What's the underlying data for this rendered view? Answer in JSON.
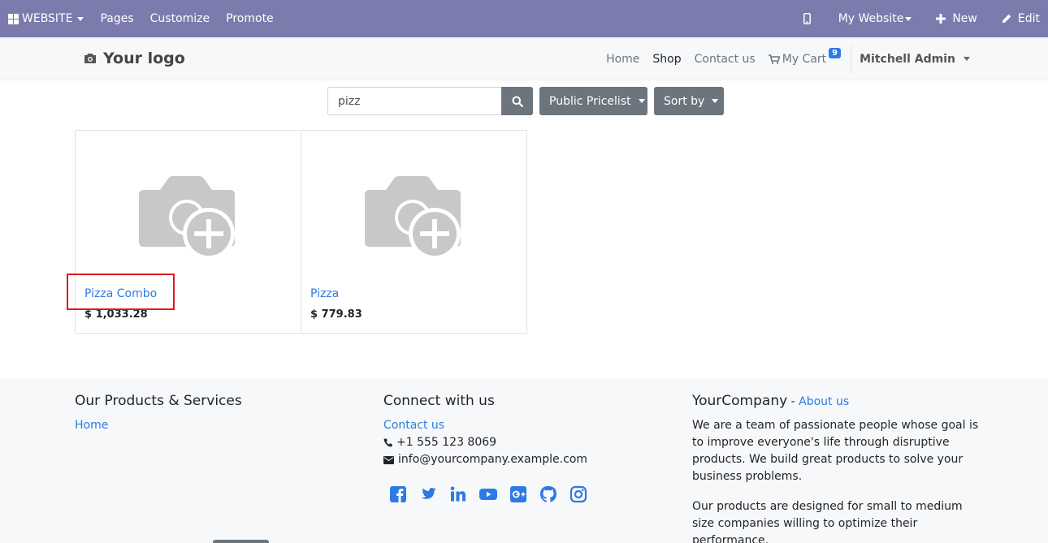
{
  "admin_bar": {
    "app_label": "WEBSITE",
    "menu": [
      "Pages",
      "Customize",
      "Promote"
    ],
    "website_selector": "My Website",
    "new_label": "New",
    "edit_label": "Edit"
  },
  "header": {
    "logo_text": "Your logo",
    "nav": [
      "Home",
      "Shop",
      "Contact us"
    ],
    "cart_label": "My Cart",
    "cart_count": "9",
    "user_name": "Mitchell Admin"
  },
  "search": {
    "value": "pizz"
  },
  "filters": {
    "pricelist_label": "Public Pricelist",
    "sort_label": "Sort by"
  },
  "products": [
    {
      "name": "Pizza Combo",
      "price": "$ 1,033.28"
    },
    {
      "name": "Pizza",
      "price": "$ 779.83"
    }
  ],
  "footer": {
    "col1": {
      "title": "Our Products & Services",
      "links": [
        "Home"
      ]
    },
    "col2": {
      "title": "Connect with us",
      "contact_link": "Contact us",
      "phone": "+1 555 123 8069",
      "email": "info@yourcompany.example.com",
      "social": [
        "facebook-icon",
        "twitter-icon",
        "linkedin-icon",
        "youtube-icon",
        "google-plus-icon",
        "github-icon",
        "instagram-icon"
      ]
    },
    "col3": {
      "title": "YourCompany",
      "title_sep": " - ",
      "about_link": "About us",
      "para1": "We are a team of passionate people whose goal is to improve everyone's life through disruptive products. We build great products to solve your business problems.",
      "para2": "Our products are designed for small to medium size companies willing to optimize their performance."
    }
  },
  "colors": {
    "admin_bar": "#7c7bad",
    "link": "#2d7ae5",
    "button": "#6c757d",
    "highlight": "#e0191b"
  }
}
